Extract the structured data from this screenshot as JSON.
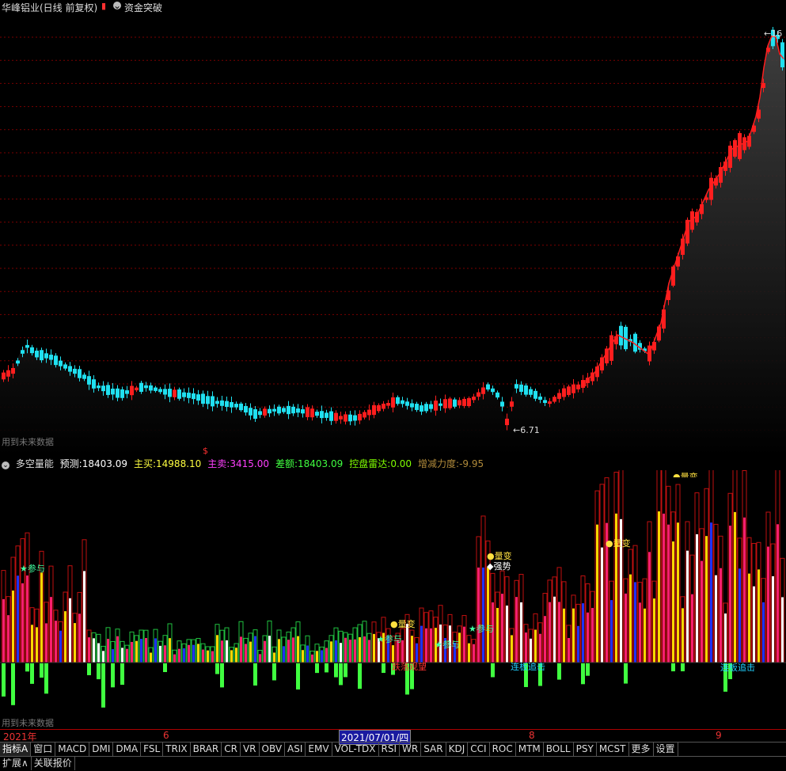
{
  "title": {
    "stock_name": "华峰铝业(日线 前复权)",
    "indicator_name": "资金突破"
  },
  "price_chart": {
    "max_price_label": "16",
    "min_price_label": "6.71",
    "future_note": "用到未来数据",
    "colors": {
      "up": "#ff1e1e",
      "down": "#20e0f0",
      "grid": "#7a0000"
    }
  },
  "indicator": {
    "name": "多空量能",
    "items": [
      {
        "label": "预测:",
        "value": "18403.09",
        "color": "#ffffff"
      },
      {
        "label": "主买:",
        "value": "14988.10",
        "color": "#ffff40"
      },
      {
        "label": "主卖:",
        "value": "3415.00",
        "color": "#ff40ff"
      },
      {
        "label": "差额:",
        "value": "18403.09",
        "color": "#40ff40"
      },
      {
        "label": "控盘雷达:",
        "value": "0.00",
        "color": "#80ff00"
      },
      {
        "label": "增减力度:",
        "value": "-9.95",
        "color": "#b08a3a"
      }
    ],
    "annotations": {
      "cj": "参与",
      "lb": "量变",
      "qs": "强势",
      "dh": "跌落观望",
      "lf": "连板追击"
    },
    "future_note": "用到未来数据"
  },
  "date_axis": {
    "labels": [
      "2021年",
      "6",
      "2021/07/01/四",
      "8",
      "9"
    ]
  },
  "tabs": [
    "指标A",
    "窗口",
    "MACD",
    "DMI",
    "DMA",
    "FSL",
    "TRIX",
    "BRAR",
    "CR",
    "VR",
    "OBV",
    "ASI",
    "EMV",
    "VOL-TDX",
    "RSI",
    "WR",
    "SAR",
    "KDJ",
    "CCI",
    "ROC",
    "MTM",
    "BOLL",
    "PSY",
    "MCST",
    "更多",
    "设置"
  ],
  "bottom_tabs": [
    "扩展∧",
    "关联报价"
  ]
}
